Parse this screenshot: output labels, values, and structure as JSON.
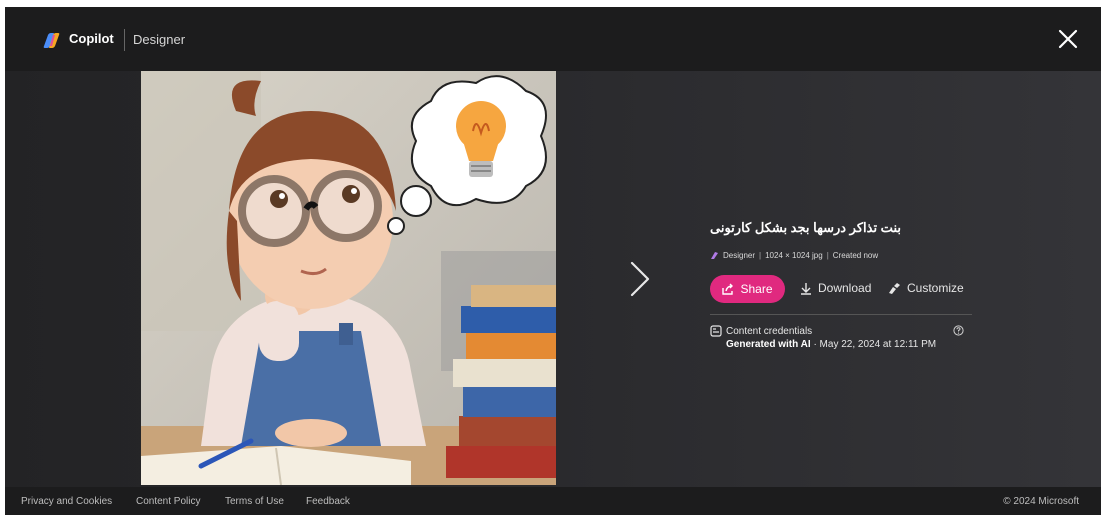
{
  "header": {
    "brand": "Copilot",
    "product": "Designer",
    "close_icon": "close-icon"
  },
  "image_panel": {
    "description_icons": [
      "thought-bubble",
      "lightbulb",
      "books"
    ]
  },
  "details": {
    "title": "بنت تذاكر درسها بجد بشكل كارتونى",
    "source_label": "Designer",
    "dimensions": "1024 × 1024 jpg",
    "created": "Created now",
    "share_label": "Share",
    "download_label": "Download",
    "customize_label": "Customize",
    "credentials_label": "Content credentials",
    "generated_label": "Generated with AI",
    "generated_date": "· May 22, 2024 at 12:11 PM"
  },
  "footer": {
    "links": [
      "Privacy and Cookies",
      "Content Policy",
      "Terms of Use",
      "Feedback"
    ],
    "copyright": "© 2024 Microsoft"
  },
  "colors": {
    "accent": "#e0297f",
    "background": "#2a2a2d",
    "header": "#1c1c1d"
  }
}
